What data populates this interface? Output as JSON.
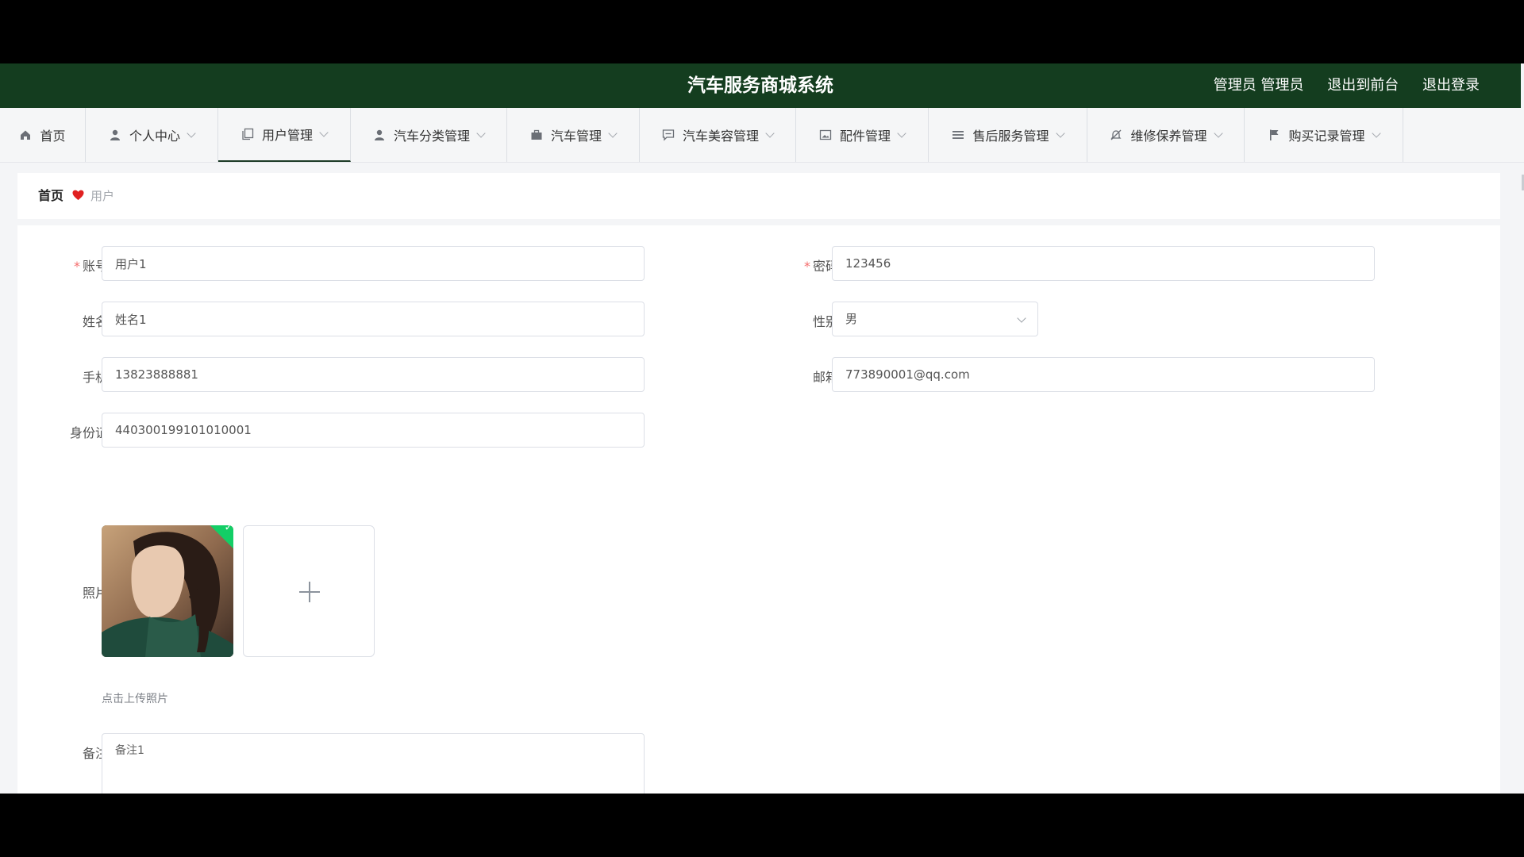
{
  "header": {
    "title": "汽车服务商城系统",
    "user": "管理员 管理员",
    "front_link": "退出到前台",
    "logout_link": "退出登录"
  },
  "nav": [
    {
      "label": "首页",
      "icon": "home-icon"
    },
    {
      "label": "个人中心",
      "icon": "user-icon"
    },
    {
      "label": "用户管理",
      "icon": "copy-icon"
    },
    {
      "label": "汽车分类管理",
      "icon": "user-icon"
    },
    {
      "label": "汽车管理",
      "icon": "briefcase-icon"
    },
    {
      "label": "汽车美容管理",
      "icon": "chat-icon"
    },
    {
      "label": "配件管理",
      "icon": "image-icon"
    },
    {
      "label": "售后服务管理",
      "icon": "list-icon"
    },
    {
      "label": "维修保养管理",
      "icon": "bell-off-icon"
    },
    {
      "label": "购买记录管理",
      "icon": "flag-icon"
    }
  ],
  "breadcrumb": {
    "home": "首页",
    "current": "用户"
  },
  "form": {
    "account_label": "账号",
    "account_value": "用户1",
    "password_label": "密码",
    "password_value": "123456",
    "name_label": "姓名",
    "name_value": "姓名1",
    "gender_label": "性别",
    "gender_value": "男",
    "phone_label": "手机",
    "phone_value": "13823888881",
    "email_label": "邮箱",
    "email_value": "773890001@qq.com",
    "idcard_label": "身份证",
    "idcard_value": "440300199101010001",
    "photo_label": "照片",
    "upload_tip": "点击上传照片",
    "note_label": "备注",
    "note_value": "备注1"
  },
  "colors": {
    "header_bg": "#143d1f",
    "required": "#f56c6c",
    "success": "#13ce66"
  }
}
